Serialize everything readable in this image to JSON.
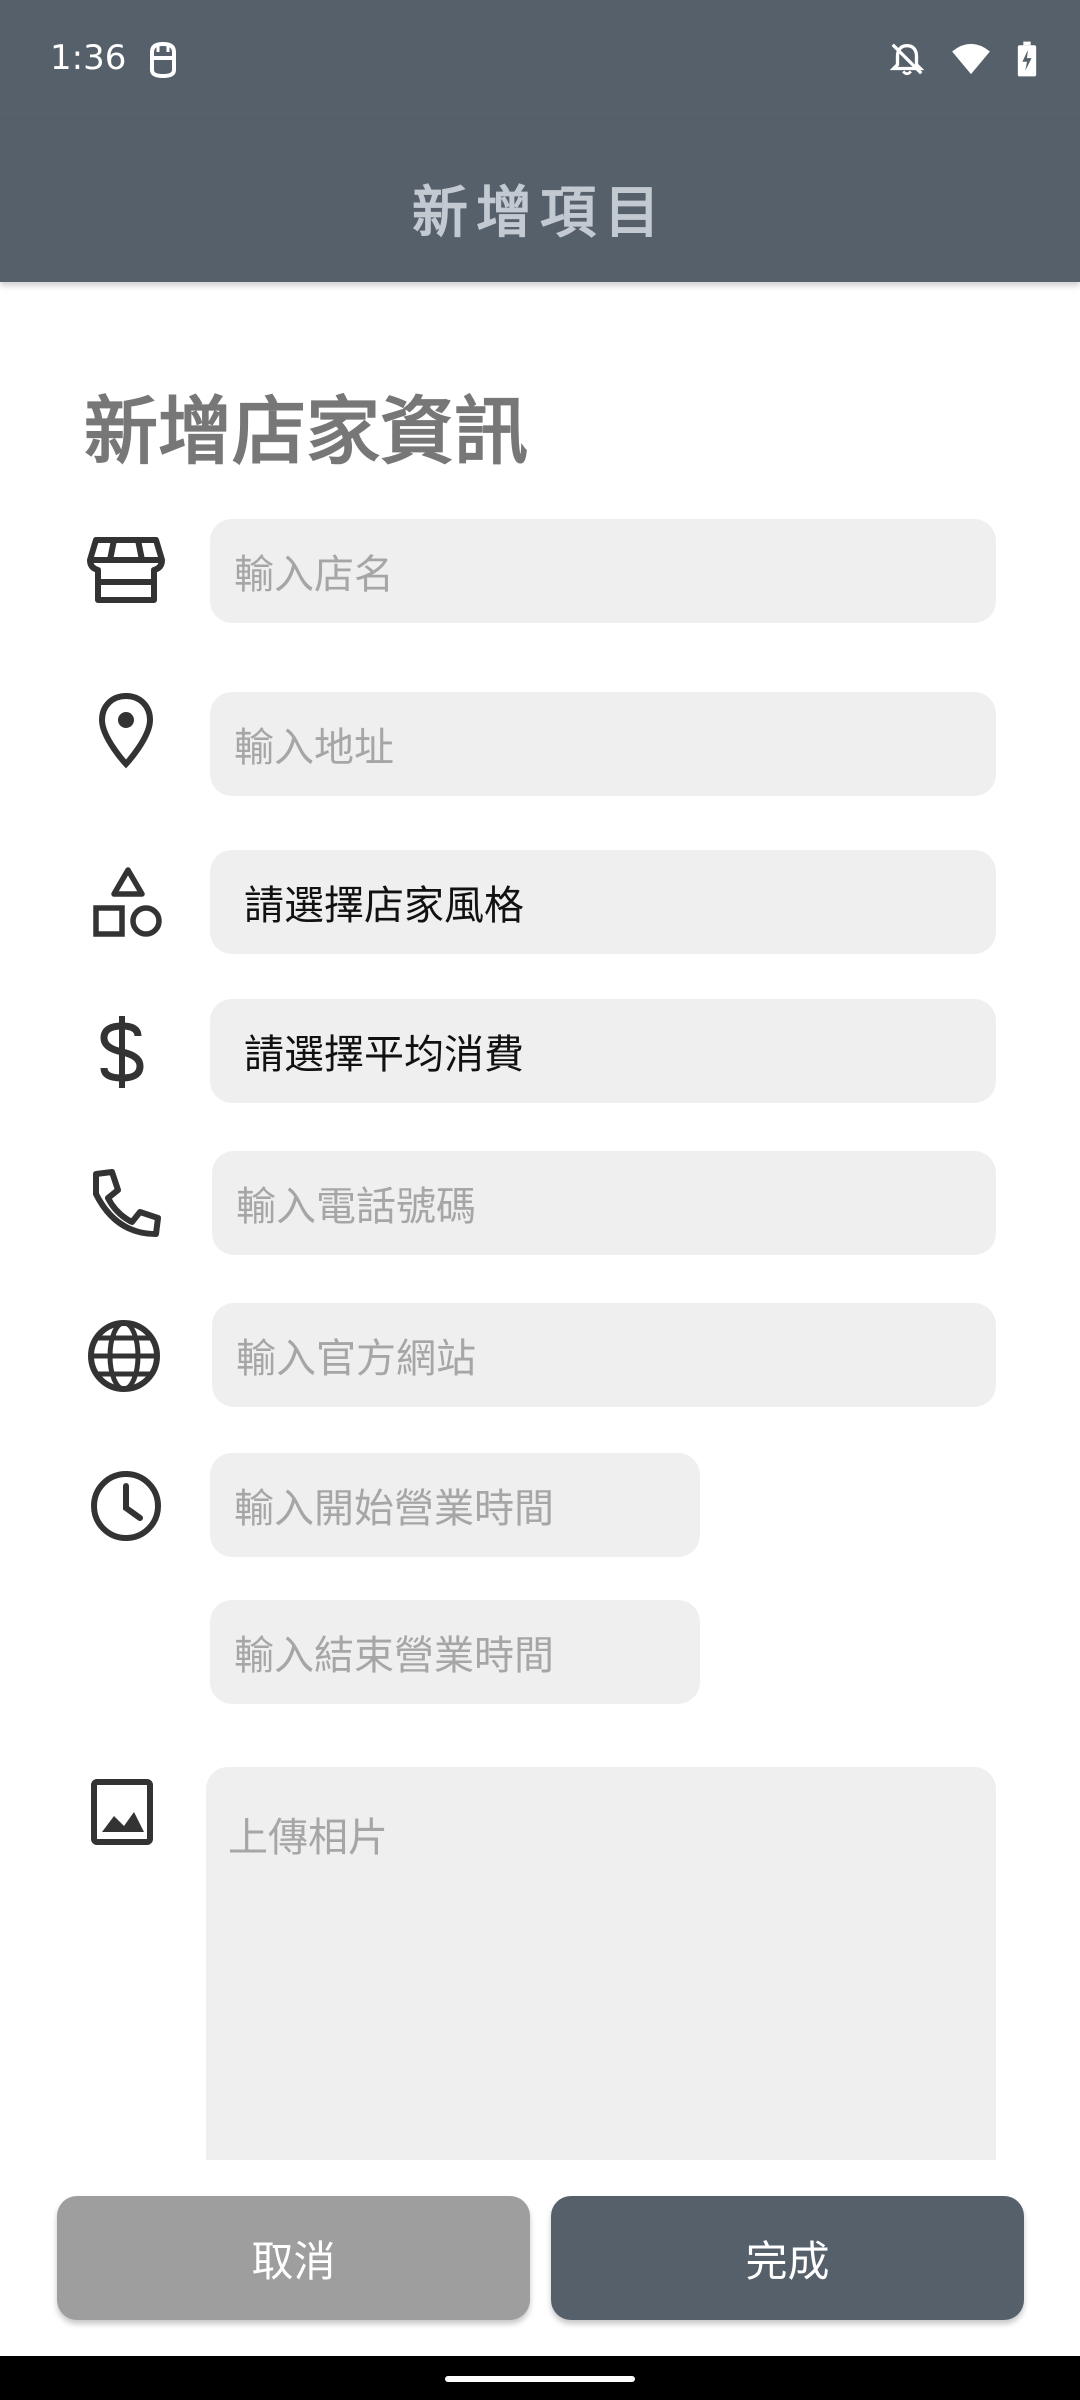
{
  "status_bar": {
    "time": "1:36",
    "icons": [
      "carrier-icon",
      "do-not-disturb-bell-icon",
      "wifi-icon",
      "battery-charging-icon"
    ]
  },
  "app_bar": {
    "title": "新增項目"
  },
  "form": {
    "section_title": "新增店家資訊",
    "store_name": {
      "placeholder": "輸入店名",
      "icon": "storefront-icon"
    },
    "address": {
      "placeholder": "輸入地址",
      "icon": "location-pin-icon"
    },
    "style": {
      "value": "請選擇店家風格",
      "icon": "category-shapes-icon"
    },
    "price": {
      "value": "請選擇平均消費",
      "icon": "dollar-icon"
    },
    "phone": {
      "placeholder": "輸入電話號碼",
      "icon": "phone-icon"
    },
    "website": {
      "placeholder": "輸入官方網站",
      "icon": "globe-icon"
    },
    "open_time": {
      "placeholder": "輸入開始營業時間",
      "icon": "clock-icon"
    },
    "close_time": {
      "placeholder": "輸入結束營業時間"
    },
    "photo": {
      "placeholder": "上傳相片",
      "icon": "image-icon"
    }
  },
  "actions": {
    "cancel_label": "取消",
    "done_label": "完成"
  },
  "colors": {
    "primary": "#56606b",
    "field_background": "#efefef",
    "placeholder_text": "#a6a6a6",
    "cancel_button": "#9e9e9e"
  }
}
